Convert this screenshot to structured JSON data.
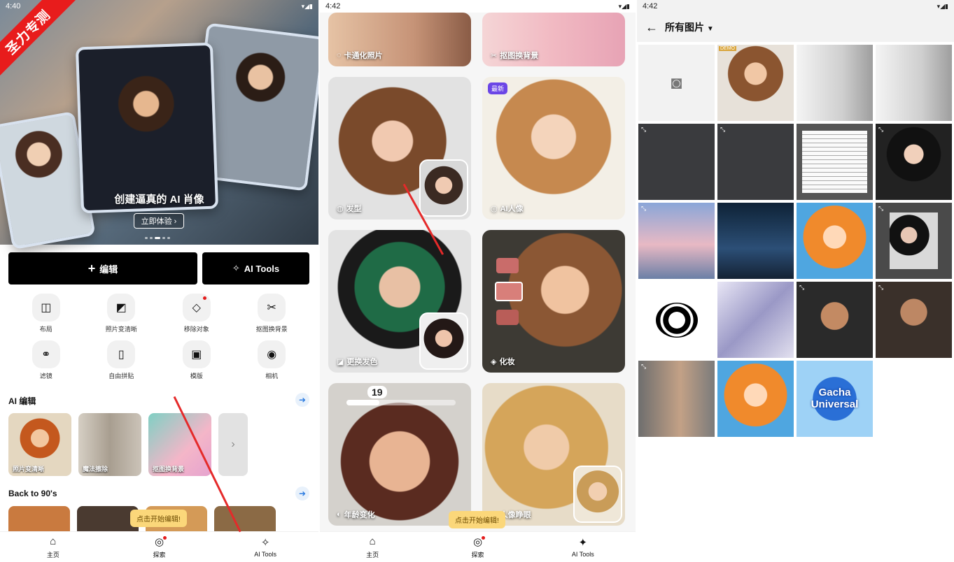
{
  "panel1": {
    "status_time": "4:40",
    "ribbon": "圣力专测",
    "hero": {
      "title": "创建逼真的 AI 肖像",
      "button": "立即体验 ›"
    },
    "edit_button": "编辑",
    "ai_tools_button": "AI Tools",
    "tools": [
      {
        "label": "布局",
        "icon": "layout-icon"
      },
      {
        "label": "照片变清晰",
        "icon": "enhance-icon"
      },
      {
        "label": "移除对象",
        "icon": "eraser-icon"
      },
      {
        "label": "抠图换背景",
        "icon": "scissors-icon"
      },
      {
        "label": "滤镜",
        "icon": "filter-icon"
      },
      {
        "label": "自由拼贴",
        "icon": "collage-icon"
      },
      {
        "label": "模版",
        "icon": "template-icon"
      },
      {
        "label": "相机",
        "icon": "camera-icon"
      }
    ],
    "ai_edit_title": "AI 编辑",
    "ai_edit_items": [
      "照片变清晰",
      "魔法擦除",
      "抠图换背景"
    ],
    "back90_title": "Back to 90's",
    "tooltip": "点击开始编辑!",
    "nav": [
      "主页",
      "探索",
      "AI Tools"
    ]
  },
  "panel2": {
    "status_time": "4:42",
    "cards": [
      {
        "label": "卡通化照片"
      },
      {
        "label": "抠图换背景"
      },
      {
        "label": "发型"
      },
      {
        "label": "AI人像",
        "badge": "最新"
      },
      {
        "label": "更换发色"
      },
      {
        "label": "化妆"
      },
      {
        "label": "年龄变化",
        "age": "19"
      },
      {
        "label": "人像睁眼"
      }
    ],
    "tooltip": "点击开始编辑!",
    "nav": [
      "主页",
      "探索",
      "AI Tools"
    ]
  },
  "panel3": {
    "status_time": "4:42",
    "title": "所有图片",
    "demo_badge": "DEMO",
    "gacha_text": "Gacha Universal"
  },
  "colors": {
    "accent_red": "#e41c1c",
    "tooltip_bg": "#fbd77a",
    "badge_purple": "#6b46e6",
    "link_blue": "#2f7de1"
  }
}
